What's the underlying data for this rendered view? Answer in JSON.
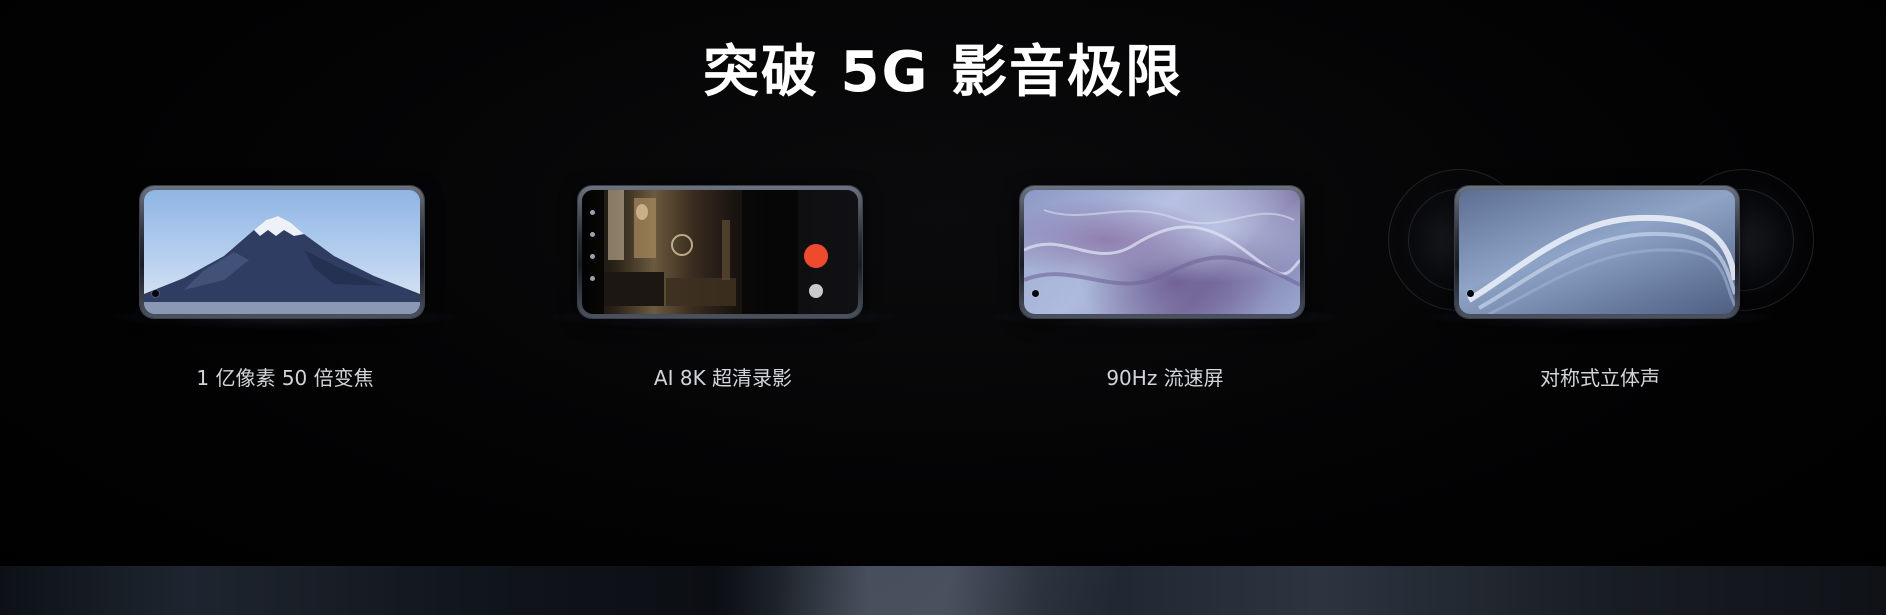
{
  "headline": "突破 5G 影音极限",
  "features": [
    {
      "caption": "1 亿像素 50 倍变焦",
      "icon": "mountain-wallpaper"
    },
    {
      "caption": "AI 8K 超清录影",
      "icon": "camera-viewfinder"
    },
    {
      "caption": "90Hz 流速屏",
      "icon": "marble-wallpaper"
    },
    {
      "caption": "对称式立体声",
      "icon": "speaker-waves"
    }
  ],
  "colors": {
    "background": "#000000",
    "headline": "#ffffff",
    "caption": "#d2d4d8",
    "shutter": "#f04a2e"
  }
}
